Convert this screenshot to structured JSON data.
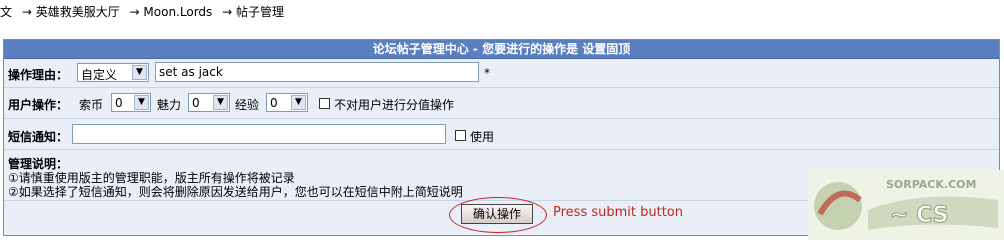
{
  "breadcrumb": {
    "items": [
      "⽂",
      "→ 英雄救美服大厅",
      "→ Moon.Lords",
      "→ 帖子管理"
    ]
  },
  "panel": {
    "title": "论坛帖子管理中心 - 您要进行的操作是  设置固顶"
  },
  "reason": {
    "label": "操作理由：",
    "select_value": "自定义",
    "input_value": "set as jack",
    "required_mark": "*"
  },
  "user_ops": {
    "label": "用户操作：",
    "coin_label": "索币",
    "coin_value": "0",
    "charm_label": "魅力",
    "charm_value": "0",
    "exp_label": "经验",
    "exp_value": "0",
    "no_points_label": "不对用户进行分值操作"
  },
  "sms": {
    "label": "短信通知：",
    "input_value": "",
    "use_label": "使用"
  },
  "notes": {
    "title": "管理说明：",
    "line1": "①请慎重使用版主的管理职能，版主所有操作将被记录",
    "line2": "②如果选择了短信通知，则会将删除原因发送给用户，您也可以在短信中附上简短说明"
  },
  "submit": {
    "label": "确认操作",
    "annotation": "Press submit button"
  },
  "watermark": {
    "text": "SORPACK.COM"
  },
  "colors": {
    "header_bg": "#5a7fc0",
    "panel_bg": "#e9eef7",
    "annotation": "#c0281c"
  }
}
